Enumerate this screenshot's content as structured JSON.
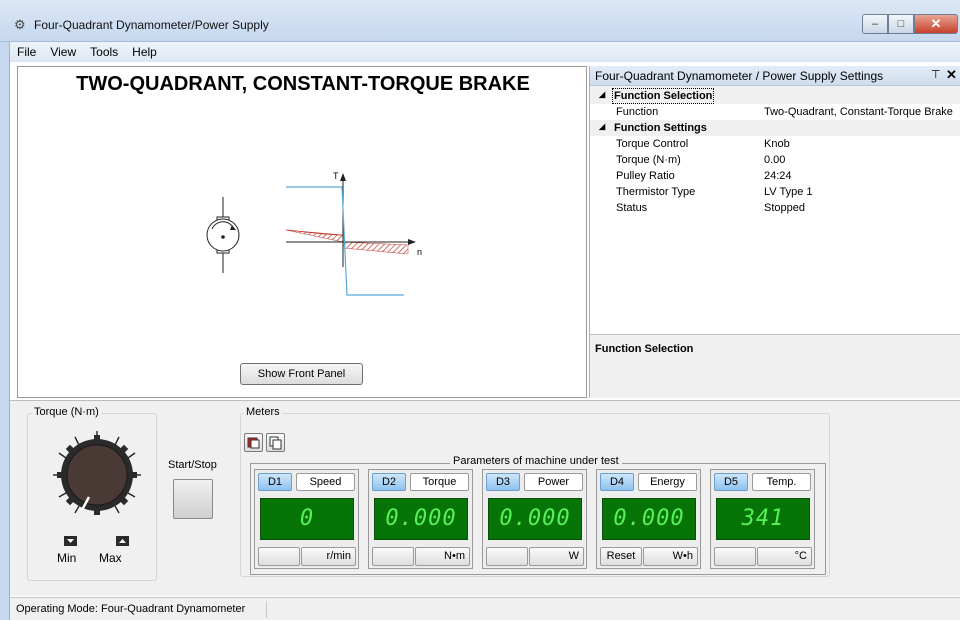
{
  "window": {
    "title": "Four-Quadrant Dynamometer/Power Supply",
    "min_glyph": "–",
    "max_glyph": "□",
    "close_glyph": "✕"
  },
  "menu": [
    {
      "label": "File"
    },
    {
      "label": "View"
    },
    {
      "label": "Tools"
    },
    {
      "label": "Help"
    }
  ],
  "diagram": {
    "title": "TWO-QUADRANT, CONSTANT-TORQUE BRAKE",
    "axis_t": "T",
    "axis_n": "n",
    "show_front_panel": "Show Front Panel"
  },
  "settings": {
    "header": "Four-Quadrant Dynamometer / Power Supply Settings",
    "pin_glyph": "⊤",
    "close_glyph": "✕",
    "rows": [
      {
        "type": "category",
        "key": "Function Selection",
        "value": ""
      },
      {
        "type": "prop",
        "key": "Function",
        "value": "Two-Quadrant, Constant-Torque Brake"
      },
      {
        "type": "category",
        "key": "Function Settings",
        "value": ""
      },
      {
        "type": "prop",
        "key": "Torque Control",
        "value": "Knob"
      },
      {
        "type": "prop",
        "key": "Torque (N·m)",
        "value": "0.00"
      },
      {
        "type": "prop",
        "key": "Pulley Ratio",
        "value": "24:24"
      },
      {
        "type": "prop",
        "key": "Thermistor Type",
        "value": "LV Type 1"
      },
      {
        "type": "prop",
        "key": "Status",
        "value": "Stopped"
      }
    ],
    "description_title": "Function Selection"
  },
  "torque_group": {
    "label": "Torque (N·m)",
    "min_label": "Min",
    "max_label": "Max",
    "knob_level": 0.0
  },
  "start_stop": {
    "label": "Start/Stop"
  },
  "meters": {
    "label": "Meters",
    "params_label": "Parameters of machine under test",
    "items": [
      {
        "id": "D1",
        "name": "Speed",
        "value": "0",
        "unit": "r/min",
        "left_button": ""
      },
      {
        "id": "D2",
        "name": "Torque",
        "value": "0.000",
        "unit": "N•m",
        "left_button": ""
      },
      {
        "id": "D3",
        "name": "Power",
        "value": "0.000",
        "unit": "W",
        "left_button": ""
      },
      {
        "id": "D4",
        "name": "Energy",
        "value": "0.000",
        "unit": "W•h",
        "left_button": "Reset"
      },
      {
        "id": "D5",
        "name": "Temp.",
        "value": "341",
        "unit": "°C",
        "left_button": ""
      }
    ]
  },
  "status_bar": {
    "text": "Operating Mode: Four-Quadrant Dynamometer"
  },
  "colors": {
    "display_bg": "#067406",
    "display_digits": "#58f058",
    "curve_line": "#5aa9d6",
    "hatch": "#c0392b"
  }
}
